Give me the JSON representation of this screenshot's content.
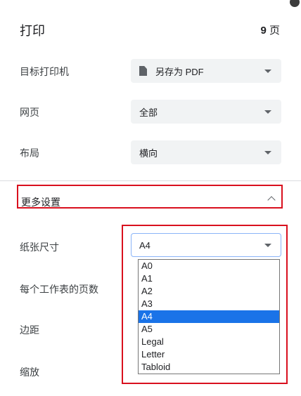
{
  "header": {
    "title": "打印",
    "page_count": "9",
    "page_unit": "页"
  },
  "settings": {
    "destination": {
      "label": "目标打印机",
      "value": "另存为 PDF",
      "icon": "document-icon"
    },
    "pages": {
      "label": "网页",
      "value": "全部"
    },
    "layout": {
      "label": "布局",
      "value": "横向"
    }
  },
  "more_settings": {
    "label": "更多设置",
    "icon": "chevron-up-icon"
  },
  "paper_size": {
    "label": "纸张尺寸",
    "value": "A4",
    "options": [
      "A0",
      "A1",
      "A2",
      "A3",
      "A4",
      "A5",
      "Legal",
      "Letter",
      "Tabloid"
    ],
    "selected": "A4"
  },
  "pages_per_sheet": {
    "label": "每个工作表的页数"
  },
  "margins": {
    "label": "边距"
  },
  "scale": {
    "label": "缩放"
  },
  "colors": {
    "highlight": "#d9101e",
    "selected": "#1a73e8"
  }
}
